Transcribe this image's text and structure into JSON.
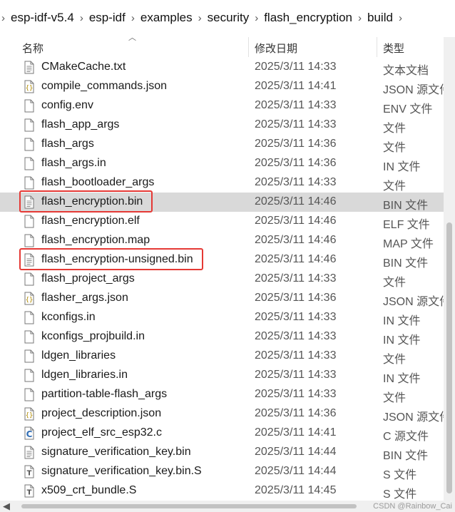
{
  "breadcrumb": [
    "esp-idf-v5.4",
    "esp-idf",
    "examples",
    "security",
    "flash_encryption",
    "build"
  ],
  "columns": {
    "name": "名称",
    "date": "修改日期",
    "type": "类型"
  },
  "files": [
    {
      "name": "CMakeCache.txt",
      "date": "2025/3/11 14:33",
      "type": "文本文档",
      "icon": "text-document-icon"
    },
    {
      "name": "compile_commands.json",
      "date": "2025/3/11 14:41",
      "type": "JSON 源文件",
      "icon": "json-file-icon"
    },
    {
      "name": "config.env",
      "date": "2025/3/11 14:33",
      "type": "ENV 文件",
      "icon": "blank-file-icon"
    },
    {
      "name": "flash_app_args",
      "date": "2025/3/11 14:33",
      "type": "文件",
      "icon": "blank-file-icon"
    },
    {
      "name": "flash_args",
      "date": "2025/3/11 14:36",
      "type": "文件",
      "icon": "blank-file-icon"
    },
    {
      "name": "flash_args.in",
      "date": "2025/3/11 14:36",
      "type": "IN 文件",
      "icon": "blank-file-icon"
    },
    {
      "name": "flash_bootloader_args",
      "date": "2025/3/11 14:33",
      "type": "文件",
      "icon": "blank-file-icon"
    },
    {
      "name": "flash_encryption.bin",
      "date": "2025/3/11 14:46",
      "type": "BIN 文件",
      "icon": "text-document-icon"
    },
    {
      "name": "flash_encryption.elf",
      "date": "2025/3/11 14:46",
      "type": "ELF 文件",
      "icon": "blank-file-icon"
    },
    {
      "name": "flash_encryption.map",
      "date": "2025/3/11 14:46",
      "type": "MAP 文件",
      "icon": "blank-file-icon"
    },
    {
      "name": "flash_encryption-unsigned.bin",
      "date": "2025/3/11 14:46",
      "type": "BIN 文件",
      "icon": "text-document-icon"
    },
    {
      "name": "flash_project_args",
      "date": "2025/3/11 14:33",
      "type": "文件",
      "icon": "blank-file-icon"
    },
    {
      "name": "flasher_args.json",
      "date": "2025/3/11 14:36",
      "type": "JSON 源文件",
      "icon": "json-file-icon"
    },
    {
      "name": "kconfigs.in",
      "date": "2025/3/11 14:33",
      "type": "IN 文件",
      "icon": "blank-file-icon"
    },
    {
      "name": "kconfigs_projbuild.in",
      "date": "2025/3/11 14:33",
      "type": "IN 文件",
      "icon": "blank-file-icon"
    },
    {
      "name": "ldgen_libraries",
      "date": "2025/3/11 14:33",
      "type": "文件",
      "icon": "blank-file-icon"
    },
    {
      "name": "ldgen_libraries.in",
      "date": "2025/3/11 14:33",
      "type": "IN 文件",
      "icon": "blank-file-icon"
    },
    {
      "name": "partition-table-flash_args",
      "date": "2025/3/11 14:33",
      "type": "文件",
      "icon": "blank-file-icon"
    },
    {
      "name": "project_description.json",
      "date": "2025/3/11 14:36",
      "type": "JSON 源文件",
      "icon": "json-file-icon"
    },
    {
      "name": "project_elf_src_esp32.c",
      "date": "2025/3/11 14:41",
      "type": "C 源文件",
      "icon": "c-source-icon"
    },
    {
      "name": "signature_verification_key.bin",
      "date": "2025/3/11 14:44",
      "type": "BIN 文件",
      "icon": "text-document-icon"
    },
    {
      "name": "signature_verification_key.bin.S",
      "date": "2025/3/11 14:44",
      "type": "S 文件",
      "icon": "s-file-icon"
    },
    {
      "name": "x509_crt_bundle.S",
      "date": "2025/3/11 14:45",
      "type": "S 文件",
      "icon": "s-file-icon"
    }
  ],
  "selected_file": "flash_encryption.bin",
  "highlighted_files": [
    "flash_encryption.bin",
    "flash_encryption-unsigned.bin"
  ],
  "colors": {
    "highlight": "#e53935",
    "selected_row": "#d9d9d9",
    "c_icon": "#2f6db5"
  },
  "watermark": "CSDN @Rainbow_Cai"
}
